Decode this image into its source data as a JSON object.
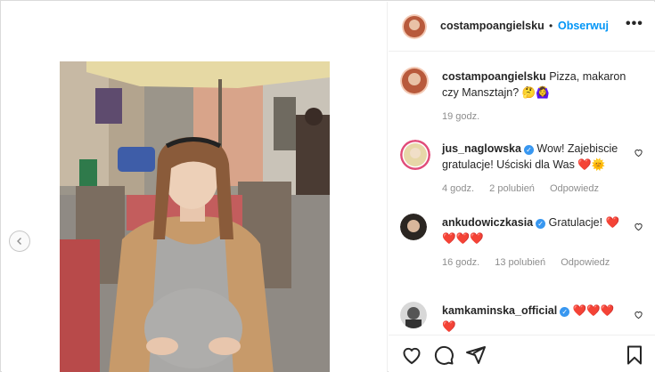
{
  "post": {
    "username": "costampoangielsku",
    "follow_label": "Obserwuj",
    "more_label": "•••",
    "separator": "•"
  },
  "caption": {
    "username": "costampoangielsku",
    "text": "Pizza, makaron czy Mansztajn? 🤔🙆‍♀️",
    "time": "19 godz."
  },
  "comments": [
    {
      "username": "jus_naglowska",
      "verified": true,
      "text": "Wow! Zajebiscie gratulacje! Uściski dla Was ❤️🌞",
      "time": "4 godz.",
      "likes": "2 polubień",
      "reply": "Odpowiedz"
    },
    {
      "username": "ankudowiczkasia",
      "verified": true,
      "text": "Gratulacje! ❤️ ❤️❤️❤️",
      "time": "16 godz.",
      "likes": "13 polubień",
      "reply": "Odpowiedz"
    },
    {
      "username": "kamkaminska_official",
      "verified": true,
      "text": "❤️❤️❤️ ❤️",
      "time": "",
      "likes": "",
      "reply": ""
    }
  ],
  "icons": {
    "prev": "chevron-left-icon",
    "like": "heart-icon",
    "comment": "comment-icon",
    "share": "send-icon",
    "save": "bookmark-icon"
  },
  "colors": {
    "link_blue": "#0095f6",
    "verified_blue": "#3897f0",
    "heart_red": "#ed4956",
    "meta_gray": "#8e8e8e"
  }
}
